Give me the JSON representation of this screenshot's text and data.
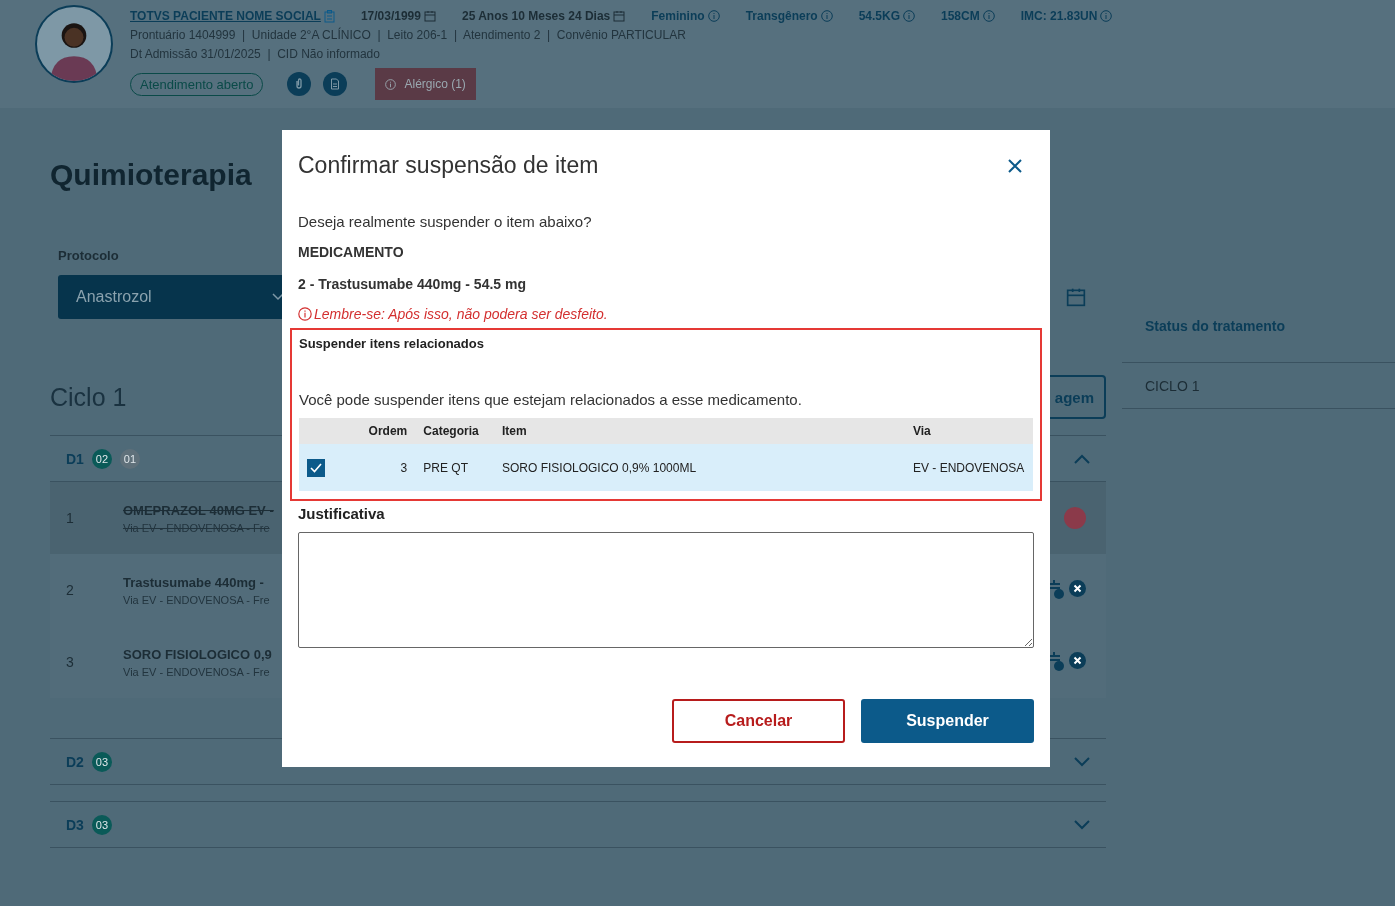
{
  "patient": {
    "name": "TOTVS PACIENTE NOME SOCIAL",
    "facts": [
      {
        "text": "17/03/1999",
        "kind": "date"
      },
      {
        "text": "25 Anos 10 Meses 24 Dias",
        "kind": "date"
      },
      {
        "text": "Feminino",
        "kind": "info"
      },
      {
        "text": "Transgênero",
        "kind": "info"
      },
      {
        "text": "54.5KG",
        "kind": "info"
      },
      {
        "text": "158CM",
        "kind": "info"
      },
      {
        "text": "IMC: 21.83UN",
        "kind": "info"
      }
    ],
    "lines": [
      "Prontuário 1404999  |  Unidade 2°A CLÍNICO  |  Leito 206-1  |  Atendimento 2  |  Convênio PARTICULAR",
      "Dt Admissão 31/01/2025  |  CID Não informado"
    ],
    "status": "Atendimento aberto",
    "allergy": "Alérgico (1)"
  },
  "page": {
    "title": "Quimioterapia",
    "protocol_label": "Protocolo",
    "protocol": "Anastrozol",
    "cycle_title": "Ciclo 1",
    "partial_button": "agem",
    "days": [
      {
        "label": "D1",
        "expanded": true,
        "badges": [
          {
            "text": "02",
            "color": "#0a5a58"
          },
          {
            "text": "01",
            "color": "#5f707a"
          }
        ],
        "items": [
          {
            "order": "1",
            "name": "OMEPRAZOL 40MG EV -",
            "detail": "Via EV - ENDOVENOSA - Fre",
            "suspended": true
          },
          {
            "order": "2",
            "name": "Trastusumabe 440mg -",
            "detail": "Via EV - ENDOVENOSA - Fre",
            "suspended": false
          },
          {
            "order": "3",
            "name": "SORO FISIOLOGICO 0,9",
            "detail": "Via EV - ENDOVENOSA - Fre",
            "suspended": false
          }
        ]
      },
      {
        "label": "D2",
        "expanded": false,
        "badges": [
          {
            "text": "03",
            "color": "#0a5a58"
          }
        ]
      },
      {
        "label": "D3",
        "expanded": false,
        "badges": [
          {
            "text": "03",
            "color": "#0a5a58"
          }
        ]
      }
    ]
  },
  "side_panel": {
    "title": "Status do tratamento",
    "items": [
      "CICLO 1"
    ]
  },
  "dialog": {
    "title": "Confirmar suspensão de item",
    "question": "Deseja realmente suspender o item abaixo?",
    "category": "MEDICAMENTO",
    "item": "2 - Trastusumabe 440mg - 54.5 mg",
    "warning": "Lembre-se: Após isso, não podera ser desfeito.",
    "related": {
      "title": "Suspender itens relacionados",
      "text": "Você pode suspender itens que estejam relacionados a esse medicamento.",
      "columns": [
        "Ordem",
        "Categoria",
        "Item",
        "Via"
      ],
      "rows": [
        {
          "checked": true,
          "cells": [
            "3",
            "PRE QT",
            "SORO FISIOLOGICO 0,9% 1000ML",
            "EV - ENDOVENOSA"
          ]
        }
      ]
    },
    "justification_label": "Justificativa",
    "buttons": [
      {
        "label": "Cancelar",
        "kind": "secondary"
      },
      {
        "label": "Suspender",
        "kind": "primary"
      }
    ]
  }
}
